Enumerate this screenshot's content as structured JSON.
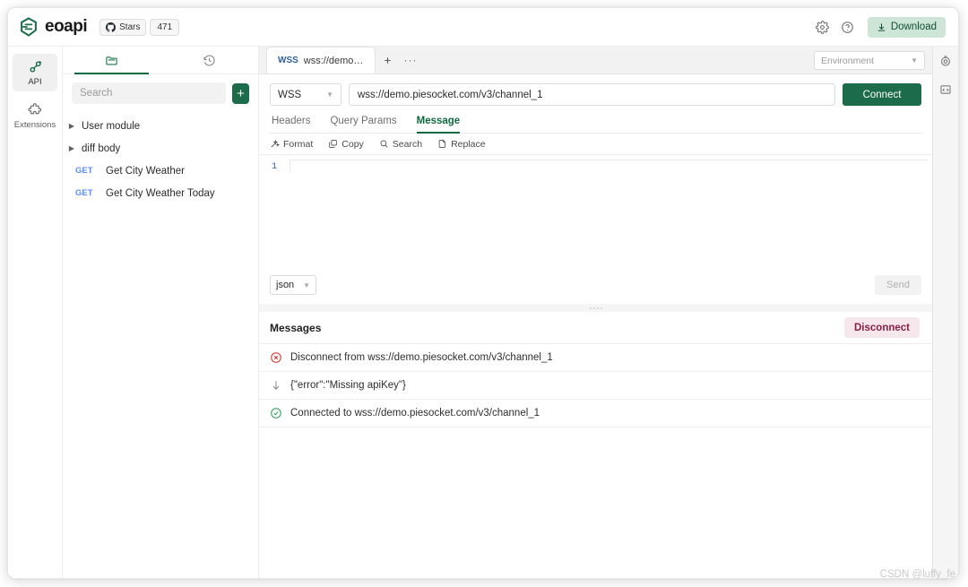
{
  "topbar": {
    "brand_name": "eoapi",
    "stars_label": "Stars",
    "stars_count": "471",
    "settings_icon": "gear-icon",
    "help_icon": "question-circle-icon",
    "download_label": "Download"
  },
  "rail": {
    "items": [
      {
        "label": "API",
        "icon": "api-icon",
        "active": true
      },
      {
        "label": "Extensions",
        "icon": "puzzle-icon",
        "active": false
      }
    ]
  },
  "sidebar": {
    "tabs": [
      {
        "name": "collection-tab",
        "icon": "folder-icon",
        "active": true
      },
      {
        "name": "history-tab",
        "icon": "history-clock-icon",
        "active": false
      }
    ],
    "search_placeholder": "Search",
    "search_value": "",
    "add_label": "+",
    "tree": [
      {
        "type": "folder",
        "label": "User module"
      },
      {
        "type": "folder",
        "label": "diff body"
      },
      {
        "type": "request",
        "method": "GET",
        "label": "Get City Weather"
      },
      {
        "type": "request",
        "method": "GET",
        "label": "Get City Weather Today"
      }
    ]
  },
  "tabstrip": {
    "tabs": [
      {
        "protocol": "WSS",
        "title": "wss://demo.p..."
      }
    ],
    "add_tab_label": "+",
    "more_label": "···",
    "environment_placeholder": "Environment",
    "env_chevron": "chevron-down-icon",
    "settings_icon": "env-settings-icon"
  },
  "request": {
    "protocol": "WSS",
    "url": "wss://demo.piesocket.com/v3/channel_1",
    "url_placeholder": "",
    "connect_label": "Connect",
    "subtabs": [
      {
        "label": "Headers",
        "active": false
      },
      {
        "label": "Query Params",
        "active": false
      },
      {
        "label": "Message",
        "active": true
      }
    ],
    "editor_tools": [
      {
        "label": "Format",
        "icon": "magic-wand-icon"
      },
      {
        "label": "Copy",
        "icon": "copy-icon"
      },
      {
        "label": "Search",
        "icon": "search-icon"
      },
      {
        "label": "Replace",
        "icon": "replace-icon"
      }
    ],
    "line_number": "1",
    "message_body": "",
    "format_value": "json",
    "send_label": "Send"
  },
  "messages": {
    "title": "Messages",
    "disconnect_label": "Disconnect",
    "items": [
      {
        "icon": "error-circle-icon",
        "text": "Disconnect from wss://demo.piesocket.com/v3/channel_1"
      },
      {
        "icon": "arrow-down-icon",
        "text": "{\"error\":\"Missing apiKey\"}"
      },
      {
        "icon": "success-check-icon",
        "text": "Connected to wss://demo.piesocket.com/v3/channel_1"
      }
    ]
  },
  "right_rail": {
    "items": [
      {
        "icon": "test-target-icon"
      },
      {
        "icon": "code-snippet-icon"
      }
    ]
  },
  "watermark": "CSDN @luffy_fe",
  "colors": {
    "brand_green": "#1c6b4a",
    "accent_green": "#0f6b3f",
    "download_bg": "#cde5d6",
    "download_text": "#0f5132",
    "disconnect_bg": "#f6e7ed",
    "disconnect_text": "#8c1f43",
    "method_blue": "#5b8ff9",
    "protocol_blue": "#2f5f9e",
    "error_red": "#d0342c",
    "success_green": "#2a9d5c"
  }
}
